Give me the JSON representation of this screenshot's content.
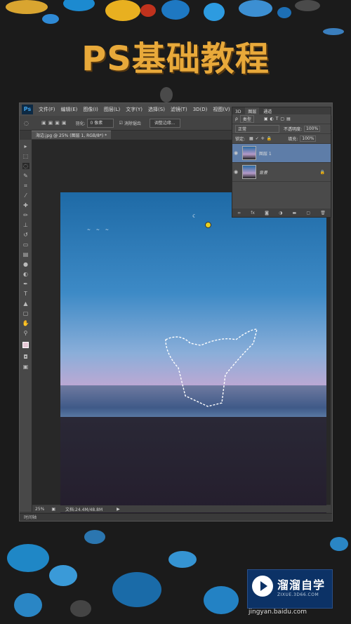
{
  "banner": {
    "title": "PS基础教程"
  },
  "ps": {
    "menu": [
      "文件(F)",
      "编辑(E)",
      "图像(I)",
      "图层(L)",
      "文字(Y)",
      "选择(S)",
      "滤镜(T)",
      "3D(D)",
      "视图(V)"
    ],
    "options": {
      "feather_label": "羽化:",
      "feather_value": "0 像素",
      "antialias_label": "消除锯齿",
      "refine_edge_button": "调整边缘..."
    },
    "document_tab": "海边.jpg @ 25% (图层 1, RGB/8*) *",
    "status": {
      "zoom": "25%",
      "doc_info": "文档:24.4M/48.8M"
    },
    "timeline_label": "时间轴"
  },
  "layers": {
    "tabs": [
      "3D",
      "图层",
      "通道"
    ],
    "kind_filter": "类型",
    "blend_mode": "正常",
    "opacity_label": "不透明度:",
    "opacity_value": "100%",
    "lock_label": "锁定:",
    "fill_label": "填充:",
    "fill_value": "100%",
    "items": [
      {
        "name": "图层 1",
        "selected": true
      },
      {
        "name": "背景",
        "selected": false
      }
    ],
    "footer_icons": [
      "link-icon",
      "fx-icon",
      "mask-icon",
      "adjustment-icon",
      "group-icon",
      "new-layer-icon",
      "trash-icon"
    ]
  },
  "watermark": {
    "name": "溜溜自学",
    "domain": "ZIXUE.3D66.COM"
  },
  "footer_url": "jingyan.baidu.com",
  "colors": {
    "title": "#e8a93a",
    "watermark_bg": "#0c3266",
    "selected_layer": "#5e7da8"
  }
}
